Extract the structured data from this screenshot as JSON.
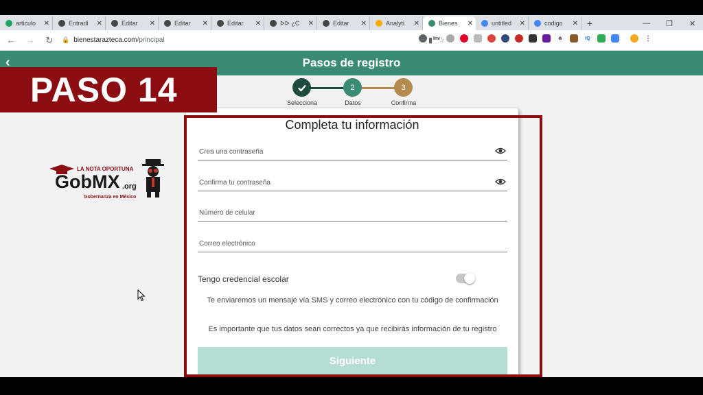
{
  "browser": {
    "tabs": [
      {
        "title": "articulo",
        "favicon": "drive-icon",
        "color": "#1fa463"
      },
      {
        "title": "Entradi",
        "favicon": "wordpress-icon",
        "color": "#464646"
      },
      {
        "title": "Editar",
        "favicon": "wordpress-icon",
        "color": "#464646"
      },
      {
        "title": "Editar",
        "favicon": "wordpress-icon",
        "color": "#464646"
      },
      {
        "title": "Editar",
        "favicon": "wordpress-icon",
        "color": "#464646"
      },
      {
        "title": "ᐅᐅ ¿C",
        "favicon": "wordpress-icon",
        "color": "#464646"
      },
      {
        "title": "Editar",
        "favicon": "wordpress-icon",
        "color": "#464646"
      },
      {
        "title": "Analyti",
        "favicon": "analytics-icon",
        "color": "#f9ab00"
      },
      {
        "title": "Bienes",
        "favicon": "app-icon",
        "color": "#3b8a73",
        "active": true
      },
      {
        "title": "untitled",
        "favicon": "doc-icon",
        "color": "#4285f4"
      },
      {
        "title": "codigo",
        "favicon": "google-icon",
        "color": "#4285f4"
      }
    ],
    "url_host": "bienestarazteca.com",
    "url_path": "/principal"
  },
  "app": {
    "header_title": "Pasos de registro"
  },
  "overlay": {
    "paso_text": "PASO 14"
  },
  "stepper": {
    "steps": [
      {
        "number": "",
        "label": "Selecciona",
        "state": "done",
        "color": "#1d4b3d"
      },
      {
        "number": "2",
        "label": "Datos",
        "state": "current",
        "color": "#3b8a73"
      },
      {
        "number": "3",
        "label": "Confirma",
        "state": "pending",
        "color": "#b48a4e"
      }
    ]
  },
  "logo": {
    "top_text": "LA NOTA OPORTUNA",
    "main_text": "GobMX",
    "suffix_text": ".org",
    "tagline": "Gobernanza en México"
  },
  "form": {
    "title": "Completa tu información",
    "fields": [
      {
        "placeholder": "Crea una contraseña",
        "has_eye": true
      },
      {
        "placeholder": "Confirma tu contraseña",
        "has_eye": true
      },
      {
        "placeholder": "Número de celular",
        "has_eye": false
      },
      {
        "placeholder": "Correo electrónico",
        "has_eye": false
      }
    ],
    "toggle_label": "Tengo credencial escolar",
    "toggle_on": false,
    "info_sms": "Te enviaremos un mensaje vía SMS y correo electrónico con tu código de confirmación",
    "info_important": "Es importante que tus datos sean correctos ya que recibirás información de tu registro",
    "submit_label": "Siguiente"
  },
  "colors": {
    "accent_green": "#3b8a73",
    "banner_red": "#8b0d12",
    "button_disabled": "#b6ddd2"
  }
}
